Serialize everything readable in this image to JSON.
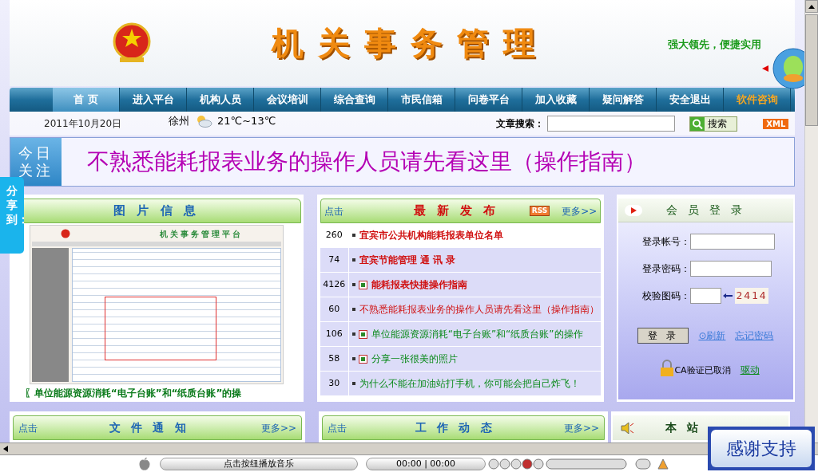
{
  "header": {
    "title": "机关事务管理",
    "slogan": "强大领先，便捷实用"
  },
  "nav": [
    {
      "label": "首 页",
      "selected": true,
      "kind": "normal"
    },
    {
      "label": "进入平台",
      "selected": false,
      "kind": "normal"
    },
    {
      "label": "机构人员",
      "selected": false,
      "kind": "normal"
    },
    {
      "label": "会议培训",
      "selected": false,
      "kind": "normal"
    },
    {
      "label": "综合查询",
      "selected": false,
      "kind": "normal"
    },
    {
      "label": "市民信箱",
      "selected": false,
      "kind": "normal"
    },
    {
      "label": "问卷平台",
      "selected": false,
      "kind": "normal"
    },
    {
      "label": "加入收藏",
      "selected": false,
      "kind": "normal"
    },
    {
      "label": "疑问解答",
      "selected": false,
      "kind": "normal"
    },
    {
      "label": "安全退出",
      "selected": false,
      "kind": "normal"
    },
    {
      "label": "软件咨询",
      "selected": false,
      "kind": "highlight"
    }
  ],
  "info_bar": {
    "date": "2011年10月20日",
    "city": "徐州",
    "temperature": "21℃~13℃",
    "search_label": "文章搜索：",
    "search_button": "搜索",
    "xml_badge": "XML"
  },
  "banner": {
    "tag": "今日关注",
    "text": "不熟悉能耗报表业务的操作人员请先看这里（操作指南）"
  },
  "share_tab": "分享到：",
  "picture_panel": {
    "title": "图 片 信 息",
    "screenshot_title": "机关事务管理平台",
    "caption": "〖单位能源资源消耗“电子台账”和“纸质台账”的操"
  },
  "news_panel": {
    "prefix": "点击",
    "title": "最 新 发 布",
    "rss": "RSS",
    "more": "更多>>",
    "items": [
      {
        "count": "260",
        "title": "宜宾市公共机构能耗报表单位名单",
        "kind": "bold-red",
        "icon": false
      },
      {
        "count": "74",
        "title": "宜宾节能管理 通 讯 录",
        "kind": "bold-red",
        "icon": false
      },
      {
        "count": "4126",
        "title": "能耗报表快捷操作指南",
        "kind": "bold-red",
        "icon": true
      },
      {
        "count": "60",
        "title": "不熟悉能耗报表业务的操作人员请先看这里（操作指南）",
        "kind": "red",
        "icon": false
      },
      {
        "count": "106",
        "title": "单位能源资源消耗“电子台账”和“纸质台账”的操作",
        "kind": "green",
        "icon": true
      },
      {
        "count": "58",
        "title": "分享一张很美的照片",
        "kind": "green",
        "icon": true
      },
      {
        "count": "30",
        "title": "为什么不能在加油站打手机，你可能会把自己炸飞！",
        "kind": "green",
        "icon": false
      }
    ]
  },
  "login_panel": {
    "title": "会 员 登 录",
    "account_label": "登录帐号：",
    "password_label": "登录密码：",
    "captcha_label": "校验图码：",
    "captcha_code": "2414",
    "login_button": "登 录",
    "refresh_link": "⊙刷新",
    "forgot_link": "忘记密码",
    "ca_status": "CA验证已取消",
    "driver_link": "驱动"
  },
  "bottom_panels": [
    {
      "prefix": "点击",
      "title": "文 件 通 知",
      "more": "更多>>"
    },
    {
      "prefix": "点击",
      "title": "工 作 动 态",
      "more": "更多>>"
    }
  ],
  "notice_panel": {
    "title": "本 站"
  },
  "thanks_badge": "感谢支持",
  "music_player": {
    "track": "点击按纽播放音乐",
    "time": "00:00 | 00:00"
  }
}
